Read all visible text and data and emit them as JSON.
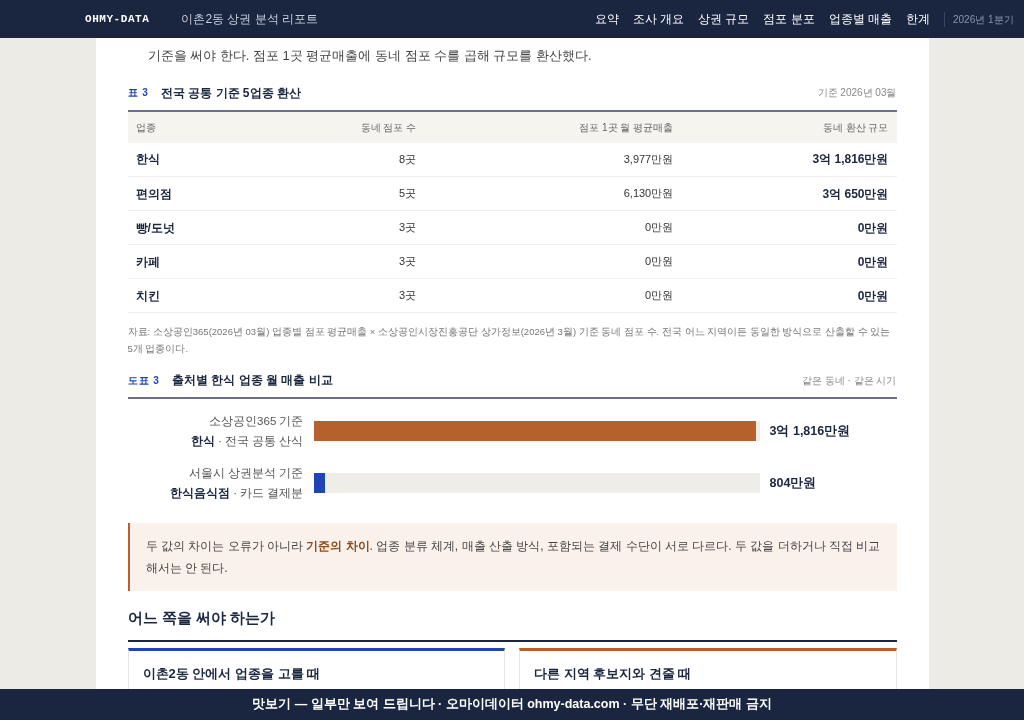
{
  "header": {
    "logo": "OHMY-DATA",
    "title": "이촌2동 상권 분석 리포트",
    "nav": [
      {
        "label": "요약"
      },
      {
        "label": "조사 개요"
      },
      {
        "label": "상권 규모"
      },
      {
        "label": "점포 분포"
      },
      {
        "label": "업종별 매출"
      },
      {
        "label": "한계"
      }
    ],
    "period": "2026년 1분기"
  },
  "intro": "기준을 써야 한다. 점포 1곳 평균매출에 동네 점포 수를 곱해 규모를 환산했다.",
  "table": {
    "tag": "표 3",
    "title": "전국 공통 기준 5업종 환산",
    "meta": "기준 2026년 03월",
    "columns": [
      "업종",
      "동네 점포 수",
      "점포 1곳 월 평균매출",
      "동네 환산 규모"
    ],
    "rows": [
      [
        "한식",
        "8곳",
        "3,977만원",
        "3억 1,816만원"
      ],
      [
        "편의점",
        "5곳",
        "6,130만원",
        "3억 650만원"
      ],
      [
        "빵/도넛",
        "3곳",
        "0만원",
        "0만원"
      ],
      [
        "카페",
        "3곳",
        "0만원",
        "0만원"
      ],
      [
        "치킨",
        "3곳",
        "0만원",
        "0만원"
      ]
    ],
    "note": "자료: 소상공인365(2026년 03월) 업종별 점포 평균매출 × 소상공인시장진흥공단 상가정보(2026년 3월) 기준 동네 점포 수. 전국 어느 지역이든 동일한 방식으로 산출할 수 있는 5개 업종이다."
  },
  "figure": {
    "tag": "도표 3",
    "title": "출처별 한식 업종 월 매출 비교",
    "meta": "같은 동네 · 같은 시기",
    "bars": [
      {
        "source": "소상공인365 기준",
        "category": "한식",
        "scope": "· 전국 공통 산식",
        "level": 1,
        "color": "#b5602d",
        "reading": "3억 1,816만원"
      },
      {
        "source": "서울시 상권분석 기준",
        "category": "한식음식점",
        "scope": "· 카드 결제분",
        "level": 0.025,
        "color": "#1f45b5",
        "reading": "804만원"
      }
    ]
  },
  "callout": "두 값의 차이는 오류가 아니라 **기준의 차이**. 업종 분류 체계, 매출 산출 방식, 포함되는 결제 수단이 서로 다르다. 두 값을 더하거나 직접 비교해서는 안 된다.",
  "section": {
    "title": "어느 쪽을 써야 하는가",
    "cards": [
      {
        "title": "이촌2동 안에서 업종을 고를 때",
        "color": "#1f45b5"
      },
      {
        "title": "다른 지역 후보지와 견줄 때",
        "color": "#b5602d"
      }
    ]
  },
  "banner": "맛보기 — 일부만 보여 드립니다 · 오마이데이터 ohmy-data.com · 무단 재배포·재판매 금지"
}
